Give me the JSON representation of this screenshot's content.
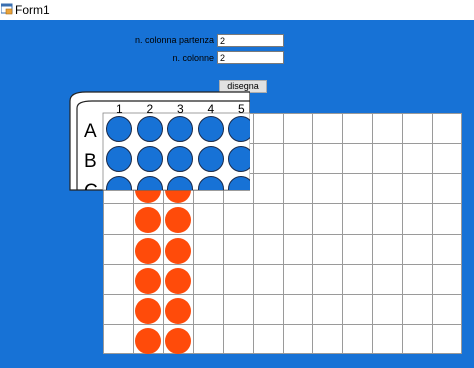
{
  "window": {
    "title": "Form1",
    "icon": "winforms-app-icon"
  },
  "form": {
    "start_column_label": "n. colonna partenza",
    "start_column_value": "2",
    "columns_label": "n. colonne",
    "columns_value": "2",
    "draw_button": "disegna"
  },
  "plate": {
    "column_numbers": [
      "1",
      "2",
      "3",
      "4",
      "5"
    ],
    "row_letters": [
      "A",
      "B",
      "C"
    ],
    "well_color": "#1772d6"
  },
  "grid": {
    "rows": 8,
    "columns": 12,
    "filled_columns": [
      2,
      3
    ],
    "fill_color": "#ff4b0a"
  },
  "colors": {
    "background": "#1772d6"
  }
}
